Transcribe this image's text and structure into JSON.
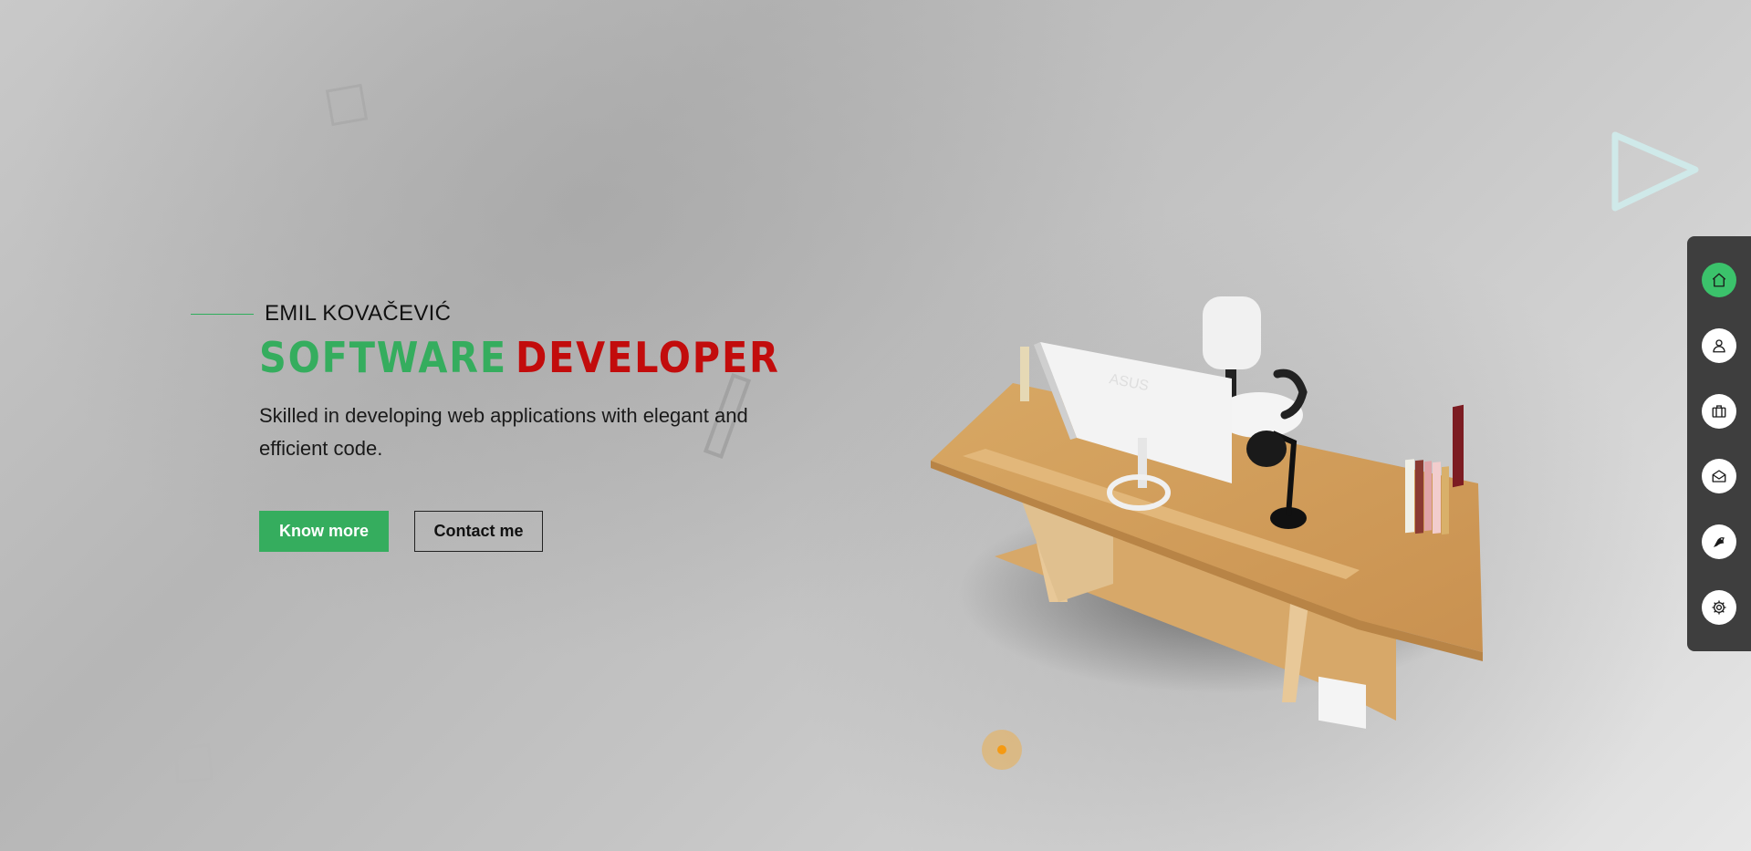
{
  "hero": {
    "name": "EMIL KOVAČEVIĆ",
    "title_part1": "SOFTWARE",
    "title_part2": "DEVELOPER",
    "description": "Skilled in developing web applications with elegant and efficient code.",
    "primary_button": "Know more",
    "secondary_button": "Contact me"
  },
  "colors": {
    "accent_green": "#35ad5e",
    "accent_red": "#c20c0c",
    "nav_background": "#3e3e3e",
    "nav_active": "#3bc26b",
    "orange_dot": "#f59a12"
  },
  "scene": {
    "monitor_brand": "ASUS"
  },
  "sidenav": {
    "items": [
      {
        "icon": "home-icon",
        "active": true
      },
      {
        "icon": "user-icon",
        "active": false
      },
      {
        "icon": "briefcase-icon",
        "active": false
      },
      {
        "icon": "mail-icon",
        "active": false
      },
      {
        "icon": "pen-nib-icon",
        "active": false
      },
      {
        "icon": "gear-icon",
        "active": false
      }
    ]
  }
}
